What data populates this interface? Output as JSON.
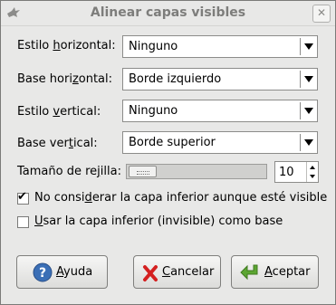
{
  "window": {
    "title": "Alinear capas visibles",
    "close_glyph": "✕"
  },
  "form": {
    "h_style": {
      "label_pre": "Estilo ",
      "label_key": "h",
      "label_post": "orizontal:",
      "value": "Ninguno"
    },
    "h_base": {
      "label_pre": "Base hori",
      "label_key": "z",
      "label_post": "ontal:",
      "value": "Borde izquierdo"
    },
    "v_style": {
      "label_pre": "Estilo ",
      "label_key": "v",
      "label_post": "ertical:",
      "value": "Ninguno"
    },
    "v_base": {
      "label_pre": "Base ver",
      "label_key": "t",
      "label_post": "ical:",
      "value": "Borde superior"
    },
    "grid": {
      "label_pre": "Tamaño de re",
      "label_key": "j",
      "label_post": "illa:",
      "value": "10",
      "slider_fraction": 0.0
    }
  },
  "options": {
    "ignore_bottom": {
      "label_pre": "No consi",
      "label_key": "d",
      "label_post": "erar la capa inferior aunque esté visible",
      "checked": true,
      "check_glyph": "✔"
    },
    "use_bottom": {
      "label_pre": "",
      "label_key": "U",
      "label_post": "sar la capa inferior (invisible) como base",
      "checked": false
    }
  },
  "buttons": {
    "help": {
      "label_pre": "",
      "label_key": "A",
      "label_post": "yuda",
      "icon": "help-icon"
    },
    "cancel": {
      "label_pre": "",
      "label_key": "C",
      "label_post": "ancelar",
      "icon": "cancel-icon"
    },
    "accept": {
      "label_pre": "",
      "label_key": "A",
      "label_post": "ceptar",
      "icon": "accept-icon"
    }
  },
  "colors": {
    "help_blue": "#3b6fb6",
    "cancel_red": "#d42020",
    "accept_green": "#5ca632"
  }
}
